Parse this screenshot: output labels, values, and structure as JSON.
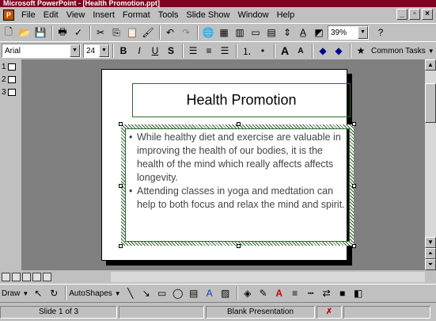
{
  "window": {
    "title": "Microsoft PowerPoint - [Health Promotion.ppt]"
  },
  "menu": [
    "File",
    "Edit",
    "View",
    "Insert",
    "Format",
    "Tools",
    "Slide Show",
    "Window",
    "Help"
  ],
  "toolbar": {
    "zoom": "39%"
  },
  "format_toolbar": {
    "font": "Arial",
    "size": "24",
    "bold": "B",
    "italic": "I",
    "underline": "U",
    "shadow": "S",
    "common_tasks": "Common Tasks"
  },
  "outline": {
    "slides": [
      "1",
      "2",
      "3"
    ]
  },
  "slide": {
    "title": "Health Promotion",
    "bullets": [
      "While healthy diet and exercise are valuable in improving the health of our bodies, it is the health of the mind which really affects affects longevity.",
      "Attending classes in yoga and medtation can help to both focus and relax the mind and spirit."
    ]
  },
  "drawbar": {
    "draw": "Draw",
    "autoshapes": "AutoShapes"
  },
  "status": {
    "slide": "Slide 1 of 3",
    "design": "Blank Presentation"
  }
}
